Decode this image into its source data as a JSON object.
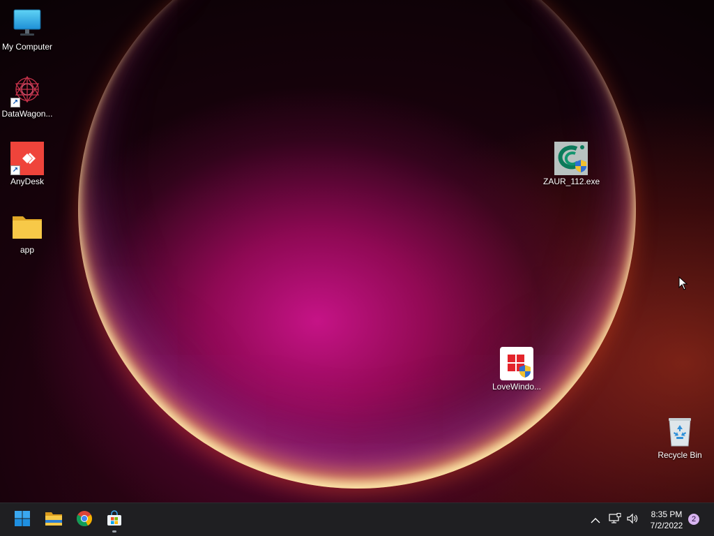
{
  "desktop_icons": {
    "my_computer": {
      "label": "My Computer",
      "icon": "monitor-icon"
    },
    "datawagon": {
      "label": "DataWagon...",
      "icon": "datawagon-icon"
    },
    "anydesk": {
      "label": "AnyDesk",
      "icon": "anydesk-icon",
      "color": "#ef443b"
    },
    "app_folder": {
      "label": "app",
      "icon": "folder-icon",
      "color": "#f7c948"
    },
    "zaur": {
      "label": "ZAUR_112.exe",
      "icon": "zaur-exe-icon"
    },
    "lovewindows": {
      "label": "LoveWindo...",
      "icon": "lovewindows-icon"
    },
    "recycle_bin": {
      "label": "Recycle Bin",
      "icon": "recycle-bin-icon"
    }
  },
  "taskbar": {
    "pinned": [
      {
        "name": "start",
        "icon": "windows-start-icon"
      },
      {
        "name": "file-explorer",
        "icon": "file-explorer-icon"
      },
      {
        "name": "chrome",
        "icon": "chrome-icon"
      },
      {
        "name": "microsoft-store",
        "icon": "store-icon"
      }
    ],
    "tray": {
      "icons": [
        "chevron-up-icon",
        "network-icon",
        "volume-icon"
      ],
      "time": "8:35 PM",
      "date": "7/2/2022",
      "notification_count": "2"
    }
  }
}
